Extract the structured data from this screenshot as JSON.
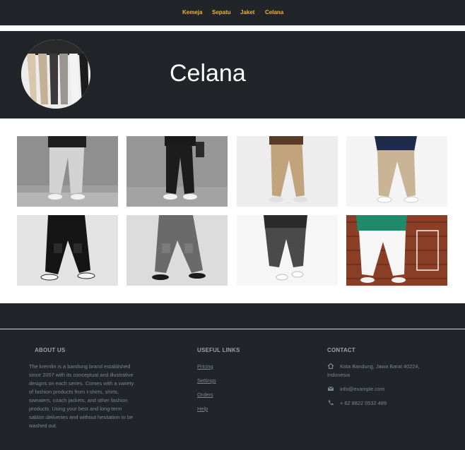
{
  "nav": {
    "items": [
      "Kemeja",
      "Sepatu",
      "Jaket",
      "Celana"
    ],
    "accent_color": "#f0b429"
  },
  "hero": {
    "title": "Celana",
    "avatar_icon": "pants-photo"
  },
  "gallery": {
    "items": [
      {
        "alt": "light-grey-jogger-pants"
      },
      {
        "alt": "black-pants"
      },
      {
        "alt": "khaki-chino-pants"
      },
      {
        "alt": "beige-chino-pants"
      },
      {
        "alt": "black-cargo-pants"
      },
      {
        "alt": "grey-cargo-pants"
      },
      {
        "alt": "dark-grey-pants"
      },
      {
        "alt": "white-pants"
      }
    ]
  },
  "footer": {
    "about": {
      "title": "ABOUT US",
      "text": "The kremlin is a bandung brand established since 2007 with its conceptual and illustrative designs on each series. Comes with a variety of fashion products from t-shirts, shirts, sweaters, coach jackets, and other fashion products. Using your best and long-term sablon deliveries and without hesitation to be washed out."
    },
    "links": {
      "title": "USEFUL LINKS",
      "items": [
        "Pricing",
        "Settings",
        "Orders",
        "Help"
      ]
    },
    "contact": {
      "title": "CONTACT",
      "address": "Kota Bandung, Jawa Barat 40224, Indonesia",
      "email": "info@example.com",
      "phone": "+ 62 8822 0532 469"
    },
    "background_color": "#212529"
  }
}
